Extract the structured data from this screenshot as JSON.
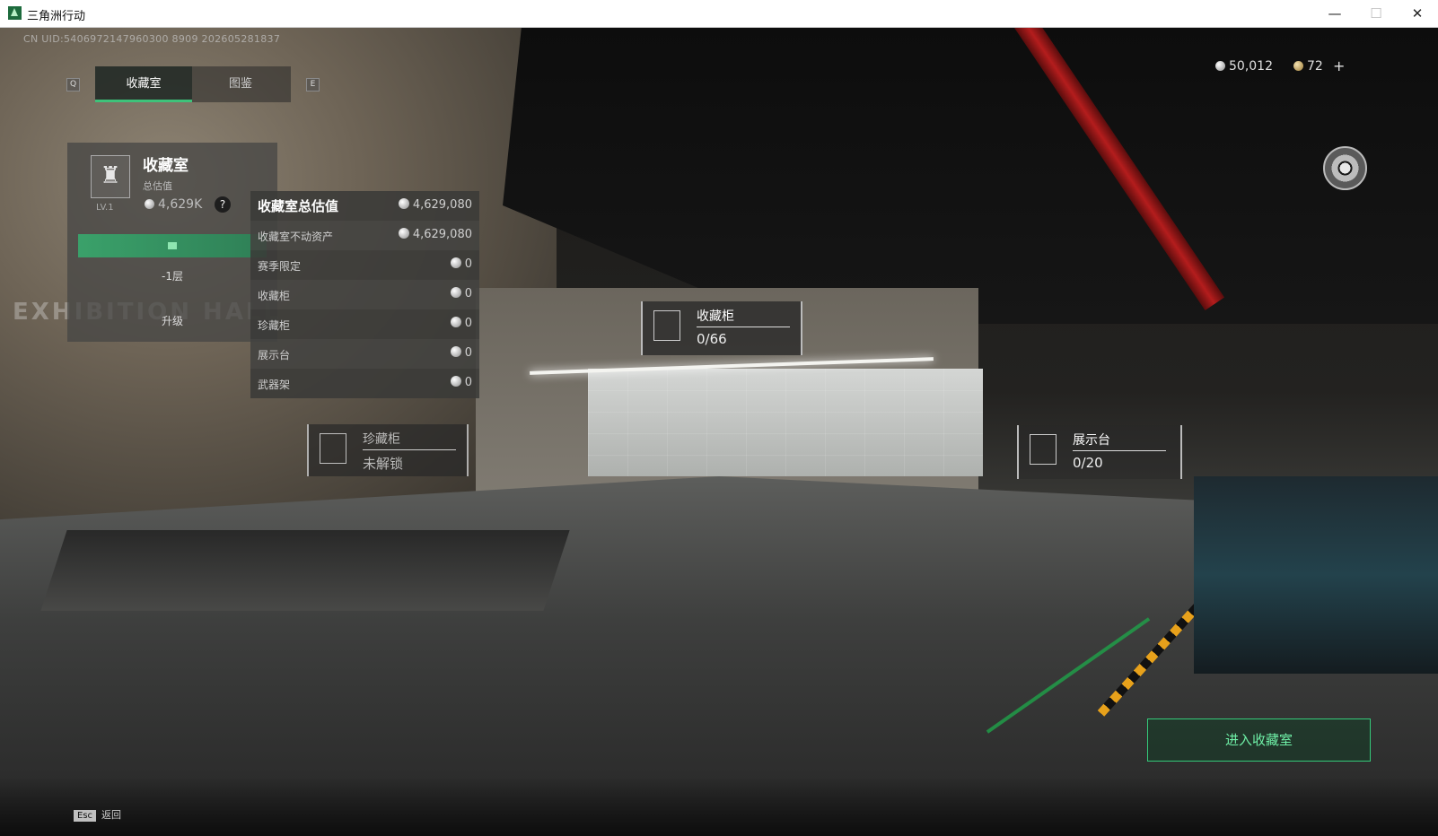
{
  "window": {
    "title": "三角洲行动",
    "min": "—",
    "max": "☐",
    "close": "✕"
  },
  "uid": "CN UID:5406972147960300 8909 202605281837",
  "tabs": {
    "key_left": "Q",
    "key_right": "E",
    "items": [
      {
        "label": "收藏室"
      },
      {
        "label": "图鉴"
      }
    ]
  },
  "currency": {
    "silver": "50,012",
    "gold": "72",
    "plus": "+"
  },
  "room": {
    "name": "收藏室",
    "level": "LV.1",
    "total_label": "总估值",
    "total_value": "4,629K",
    "help": "?",
    "floor": "-1层",
    "upgrade": "升级",
    "bg_text": "EXHIBITION HALL"
  },
  "value_panel": {
    "rows": [
      {
        "label": "收藏室总估值",
        "value": "4,629,080"
      },
      {
        "label": "收藏室不动资产",
        "value": "4,629,080"
      },
      {
        "label": "赛季限定",
        "value": "0"
      },
      {
        "label": "收藏柜",
        "value": "0"
      },
      {
        "label": "珍藏柜",
        "value": "0"
      },
      {
        "label": "展示台",
        "value": "0"
      },
      {
        "label": "武器架",
        "value": "0"
      }
    ]
  },
  "markers": {
    "cabinet": {
      "title": "收藏柜",
      "value": "0/66"
    },
    "rare": {
      "title": "珍藏柜",
      "value": "未解锁"
    },
    "stand": {
      "title": "展示台",
      "value": "0/20"
    }
  },
  "enter_button": "进入收藏室",
  "esc": {
    "key": "Esc",
    "label": "返回"
  }
}
